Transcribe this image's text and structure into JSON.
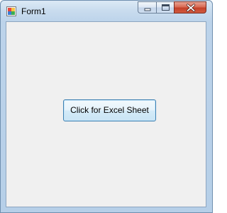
{
  "window": {
    "title": "Form1",
    "icon": "winforms-app-icon"
  },
  "titlebar_controls": {
    "minimize_icon": "minimize-icon",
    "maximize_icon": "maximize-icon",
    "close_icon": "close-icon"
  },
  "form": {
    "button_label": "Click for Excel Sheet"
  },
  "colors": {
    "client_background": "#f0f0f0",
    "button_border": "#3c7fb1",
    "close_button": "#c4412a"
  }
}
